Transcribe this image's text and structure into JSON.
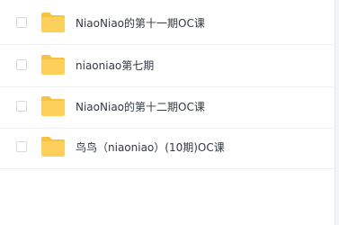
{
  "colors": {
    "folder": "#fdd05c",
    "folder_tab": "#f6c244",
    "text": "#333842",
    "divider": "#f1f2f4",
    "checkbox_border": "#d6d9de"
  },
  "files": [
    {
      "name": "NiaoNiao的第十一期OC课",
      "type": "folder",
      "icon": "folder-icon",
      "checked": false
    },
    {
      "name": "niaoniao第七期",
      "type": "folder",
      "icon": "folder-icon",
      "checked": false
    },
    {
      "name": "NiaoNiao的第十二期OC课",
      "type": "folder",
      "icon": "folder-icon",
      "checked": false
    },
    {
      "name": "鸟鸟（niaoniao）(10期)OC课",
      "type": "folder",
      "icon": "folder-icon",
      "checked": false
    }
  ]
}
